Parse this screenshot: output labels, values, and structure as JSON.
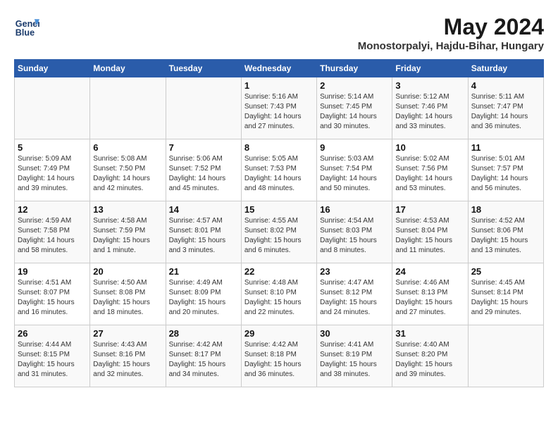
{
  "header": {
    "logo_line1": "General",
    "logo_line2": "Blue",
    "month_year": "May 2024",
    "location": "Monostorpalyi, Hajdu-Bihar, Hungary"
  },
  "days_of_week": [
    "Sunday",
    "Monday",
    "Tuesday",
    "Wednesday",
    "Thursday",
    "Friday",
    "Saturday"
  ],
  "weeks": [
    [
      {
        "day": "",
        "text": ""
      },
      {
        "day": "",
        "text": ""
      },
      {
        "day": "",
        "text": ""
      },
      {
        "day": "1",
        "text": "Sunrise: 5:16 AM\nSunset: 7:43 PM\nDaylight: 14 hours\nand 27 minutes."
      },
      {
        "day": "2",
        "text": "Sunrise: 5:14 AM\nSunset: 7:45 PM\nDaylight: 14 hours\nand 30 minutes."
      },
      {
        "day": "3",
        "text": "Sunrise: 5:12 AM\nSunset: 7:46 PM\nDaylight: 14 hours\nand 33 minutes."
      },
      {
        "day": "4",
        "text": "Sunrise: 5:11 AM\nSunset: 7:47 PM\nDaylight: 14 hours\nand 36 minutes."
      }
    ],
    [
      {
        "day": "5",
        "text": "Sunrise: 5:09 AM\nSunset: 7:49 PM\nDaylight: 14 hours\nand 39 minutes."
      },
      {
        "day": "6",
        "text": "Sunrise: 5:08 AM\nSunset: 7:50 PM\nDaylight: 14 hours\nand 42 minutes."
      },
      {
        "day": "7",
        "text": "Sunrise: 5:06 AM\nSunset: 7:52 PM\nDaylight: 14 hours\nand 45 minutes."
      },
      {
        "day": "8",
        "text": "Sunrise: 5:05 AM\nSunset: 7:53 PM\nDaylight: 14 hours\nand 48 minutes."
      },
      {
        "day": "9",
        "text": "Sunrise: 5:03 AM\nSunset: 7:54 PM\nDaylight: 14 hours\nand 50 minutes."
      },
      {
        "day": "10",
        "text": "Sunrise: 5:02 AM\nSunset: 7:56 PM\nDaylight: 14 hours\nand 53 minutes."
      },
      {
        "day": "11",
        "text": "Sunrise: 5:01 AM\nSunset: 7:57 PM\nDaylight: 14 hours\nand 56 minutes."
      }
    ],
    [
      {
        "day": "12",
        "text": "Sunrise: 4:59 AM\nSunset: 7:58 PM\nDaylight: 14 hours\nand 58 minutes."
      },
      {
        "day": "13",
        "text": "Sunrise: 4:58 AM\nSunset: 7:59 PM\nDaylight: 15 hours\nand 1 minute."
      },
      {
        "day": "14",
        "text": "Sunrise: 4:57 AM\nSunset: 8:01 PM\nDaylight: 15 hours\nand 3 minutes."
      },
      {
        "day": "15",
        "text": "Sunrise: 4:55 AM\nSunset: 8:02 PM\nDaylight: 15 hours\nand 6 minutes."
      },
      {
        "day": "16",
        "text": "Sunrise: 4:54 AM\nSunset: 8:03 PM\nDaylight: 15 hours\nand 8 minutes."
      },
      {
        "day": "17",
        "text": "Sunrise: 4:53 AM\nSunset: 8:04 PM\nDaylight: 15 hours\nand 11 minutes."
      },
      {
        "day": "18",
        "text": "Sunrise: 4:52 AM\nSunset: 8:06 PM\nDaylight: 15 hours\nand 13 minutes."
      }
    ],
    [
      {
        "day": "19",
        "text": "Sunrise: 4:51 AM\nSunset: 8:07 PM\nDaylight: 15 hours\nand 16 minutes."
      },
      {
        "day": "20",
        "text": "Sunrise: 4:50 AM\nSunset: 8:08 PM\nDaylight: 15 hours\nand 18 minutes."
      },
      {
        "day": "21",
        "text": "Sunrise: 4:49 AM\nSunset: 8:09 PM\nDaylight: 15 hours\nand 20 minutes."
      },
      {
        "day": "22",
        "text": "Sunrise: 4:48 AM\nSunset: 8:10 PM\nDaylight: 15 hours\nand 22 minutes."
      },
      {
        "day": "23",
        "text": "Sunrise: 4:47 AM\nSunset: 8:12 PM\nDaylight: 15 hours\nand 24 minutes."
      },
      {
        "day": "24",
        "text": "Sunrise: 4:46 AM\nSunset: 8:13 PM\nDaylight: 15 hours\nand 27 minutes."
      },
      {
        "day": "25",
        "text": "Sunrise: 4:45 AM\nSunset: 8:14 PM\nDaylight: 15 hours\nand 29 minutes."
      }
    ],
    [
      {
        "day": "26",
        "text": "Sunrise: 4:44 AM\nSunset: 8:15 PM\nDaylight: 15 hours\nand 31 minutes."
      },
      {
        "day": "27",
        "text": "Sunrise: 4:43 AM\nSunset: 8:16 PM\nDaylight: 15 hours\nand 32 minutes."
      },
      {
        "day": "28",
        "text": "Sunrise: 4:42 AM\nSunset: 8:17 PM\nDaylight: 15 hours\nand 34 minutes."
      },
      {
        "day": "29",
        "text": "Sunrise: 4:42 AM\nSunset: 8:18 PM\nDaylight: 15 hours\nand 36 minutes."
      },
      {
        "day": "30",
        "text": "Sunrise: 4:41 AM\nSunset: 8:19 PM\nDaylight: 15 hours\nand 38 minutes."
      },
      {
        "day": "31",
        "text": "Sunrise: 4:40 AM\nSunset: 8:20 PM\nDaylight: 15 hours\nand 39 minutes."
      },
      {
        "day": "",
        "text": ""
      }
    ]
  ]
}
